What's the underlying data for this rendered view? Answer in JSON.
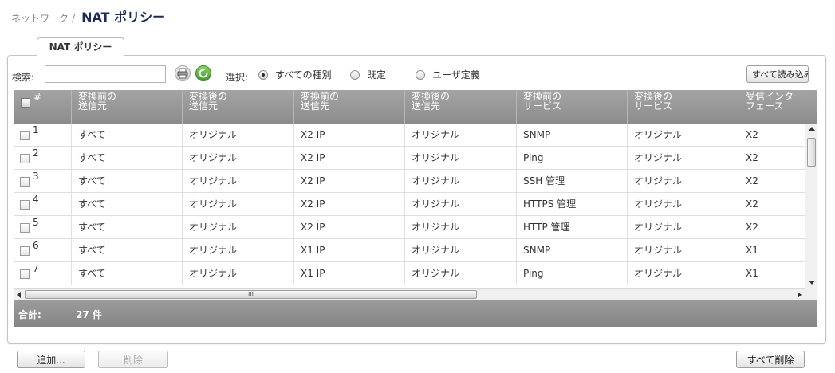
{
  "breadcrumb": {
    "parent": "ネットワーク",
    "separator": "/",
    "title": "NAT ポリシー"
  },
  "tab": {
    "label": "NAT ポリシー"
  },
  "toolbar": {
    "search_label": "検索:",
    "search_value": "",
    "print_icon": "print-icon",
    "refresh_icon": "refresh-icon",
    "select_label": "選択:",
    "radio_all": "すべての種別",
    "radio_default": "既定",
    "radio_user": "ユーザ定義",
    "selected_radio": "all",
    "read_all_label": "すべて読み込み"
  },
  "table": {
    "check_header": "#",
    "columns": [
      "変換前の\n送信元",
      "変換後の\n送信元",
      "変換前の\n送信先",
      "変換後の\n送信先",
      "変換前の\nサービス",
      "変換後の\nサービス",
      "受信インター\nフェース"
    ],
    "rows": [
      {
        "num": "1",
        "cells": [
          "すべて",
          "オリジナル",
          "X2 IP",
          "オリジナル",
          "SNMP",
          "オリジナル",
          "X2"
        ]
      },
      {
        "num": "2",
        "cells": [
          "すべて",
          "オリジナル",
          "X2 IP",
          "オリジナル",
          "Ping",
          "オリジナル",
          "X2"
        ]
      },
      {
        "num": "3",
        "cells": [
          "すべて",
          "オリジナル",
          "X2 IP",
          "オリジナル",
          "SSH 管理",
          "オリジナル",
          "X2"
        ]
      },
      {
        "num": "4",
        "cells": [
          "すべて",
          "オリジナル",
          "X2 IP",
          "オリジナル",
          "HTTPS 管理",
          "オリジナル",
          "X2"
        ]
      },
      {
        "num": "5",
        "cells": [
          "すべて",
          "オリジナル",
          "X2 IP",
          "オリジナル",
          "HTTP 管理",
          "オリジナル",
          "X2"
        ]
      },
      {
        "num": "6",
        "cells": [
          "すべて",
          "オリジナル",
          "X1 IP",
          "オリジナル",
          "SNMP",
          "オリジナル",
          "X1"
        ]
      },
      {
        "num": "7",
        "cells": [
          "すべて",
          "オリジナル",
          "X1 IP",
          "オリジナル",
          "Ping",
          "オリジナル",
          "X1"
        ]
      }
    ],
    "hscroll_grip": "III",
    "total_label": "合計:",
    "total_count": "27 件"
  },
  "actions": {
    "add_label": "追加...",
    "delete_label": "削除",
    "delete_all_label": "すべて削除"
  },
  "colors": {
    "title": "#1c2a5a",
    "header_bg": "#999999",
    "refresh_green": "#3e9a2b"
  }
}
